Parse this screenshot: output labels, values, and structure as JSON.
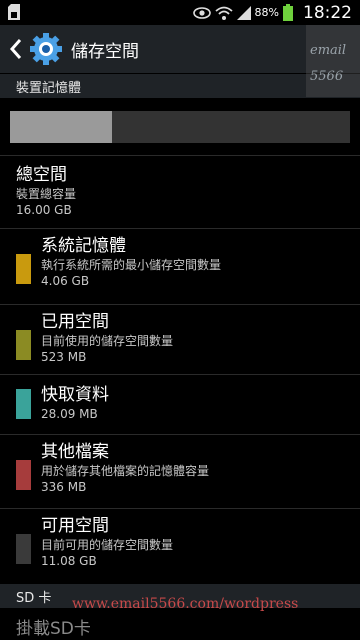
{
  "status_bar": {
    "battery_percent": "88%",
    "time": "18:22",
    "battery_level": 0.88,
    "icons": [
      "sd-card-icon",
      "eye-icon",
      "wifi-icon",
      "signal-icon",
      "battery-icon"
    ]
  },
  "header": {
    "title": "儲存空間",
    "icon": "gear-icon"
  },
  "watermark": {
    "line1": "email",
    "line2": "5566",
    "footer": "www.email5566.com/wordpress"
  },
  "device_section": {
    "header": "裝置記憶體",
    "used_fraction": 0.3
  },
  "total": {
    "title": "總空間",
    "subtitle": "裝置總容量",
    "size": "16.00 GB"
  },
  "items": [
    {
      "title": "系統記憶體",
      "subtitle": "執行系統所需的最小儲存空間數量",
      "size": "4.06 GB",
      "color": "#c99a0e"
    },
    {
      "title": "已用空間",
      "subtitle": "目前使用的儲存空間數量",
      "size": "523 MB",
      "color": "#8b8b23"
    },
    {
      "title": "快取資料",
      "subtitle": "",
      "size": "28.09 MB",
      "color": "#3aa39a"
    },
    {
      "title": "其他檔案",
      "subtitle": "用於儲存其他檔案的記憶體容量",
      "size": "336 MB",
      "color": "#a63c3c"
    },
    {
      "title": "可用空間",
      "subtitle": "目前可用的儲存空間數量",
      "size": "11.08 GB",
      "color": "#3a3a3a"
    }
  ],
  "sd_section": {
    "header": "SD 卡",
    "mount_label": "掛載SD卡"
  }
}
